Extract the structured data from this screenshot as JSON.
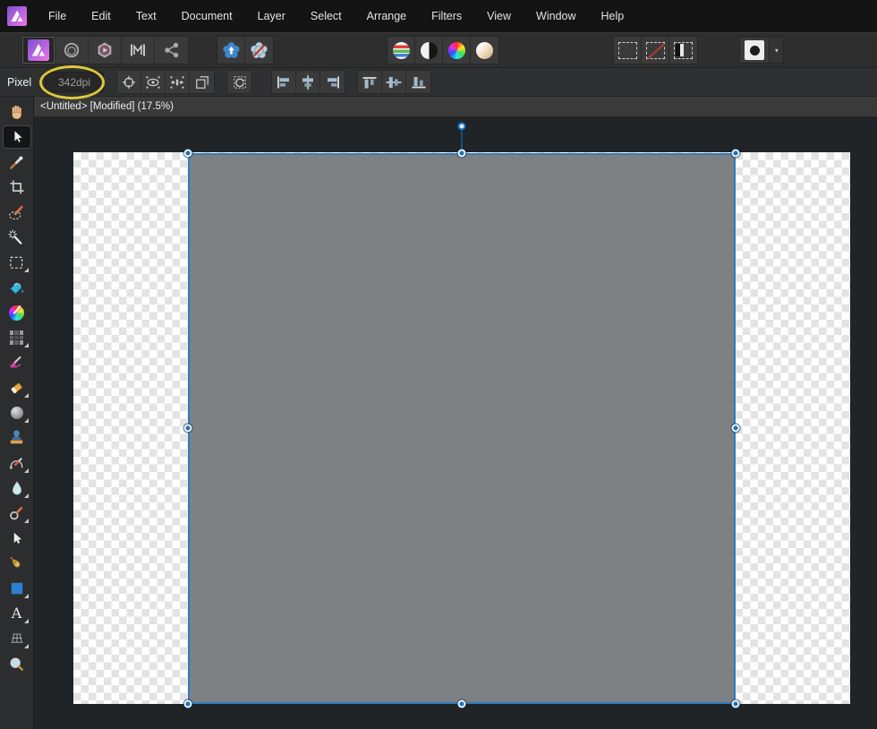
{
  "app": {
    "name_icon": "affinity-photo-logo"
  },
  "menubar": {
    "items": [
      "File",
      "Edit",
      "Text",
      "Document",
      "Layer",
      "Select",
      "Arrange",
      "Filters",
      "View",
      "Window",
      "Help"
    ]
  },
  "toolbar": {
    "personas": [
      "photo-persona",
      "liquify-persona",
      "develop-persona",
      "tone-mapping-persona",
      "export-persona"
    ],
    "active_persona": "photo-persona",
    "toggles": [
      "flower-arrow-toggle",
      "flower-slash-toggle"
    ],
    "auto_adjustments": [
      "auto-levels",
      "auto-contrast",
      "auto-colours",
      "auto-white-balance"
    ],
    "selection_actions": [
      "selection-marquee",
      "deselect",
      "invert-selection"
    ],
    "mask_button": "quick-mask",
    "mask_dropdown": "▼"
  },
  "context_toolbar": {
    "persona_label": "Pixel",
    "dpi_field": {
      "value": "342dpi"
    },
    "move_options": [
      "transform-origin",
      "hide-selection-while-dragging",
      "show-alignment-handles",
      "transform-objects-separately",
      "cycle-selection-box"
    ],
    "align_options": [
      "align-left",
      "align-center-horizontal",
      "align-right",
      "align-top",
      "align-middle-vertical",
      "align-bottom"
    ]
  },
  "document_tab": {
    "title": "<Untitled> [Modified] (17.5%)"
  },
  "tools": {
    "selected": "move-tool",
    "text_glyph": "A",
    "items": [
      "view-tool",
      "move-tool",
      "colour-picker-tool",
      "crop-tool",
      "selection-brush-tool",
      "flood-select-tool",
      "marquee-tool",
      "flood-fill-tool",
      "gradient-tool",
      "pixel-tool",
      "paint-brush-tool",
      "erase-brush-tool",
      "dodge-brush-tool",
      "clone-brush-tool",
      "undo-brush-tool",
      "blur-brush-tool",
      "healing-brush-tool",
      "node-tool",
      "pen-tool",
      "rectangle-tool",
      "artistic-text-tool",
      "mesh-warp-tool",
      "zoom-tool"
    ]
  },
  "canvas": {
    "zoom_percent": "17.5%",
    "selection": {
      "object_fill": "#7e8184",
      "border_color": "#2e7cc0",
      "handle_color": "#1b72ba",
      "handles": [
        "top-left",
        "top-center",
        "top-right",
        "middle-left",
        "middle-right",
        "bottom-left",
        "bottom-center",
        "bottom-right",
        "rotation"
      ]
    }
  },
  "annotation": {
    "shape": "ellipse",
    "color": "#ddc83b",
    "highlights": "dpi-field"
  },
  "colors": {
    "accent_blue": "#2e7cc0",
    "annotation_yellow": "#ddc83b",
    "pasteboard": "#212426",
    "toolbar_bg": "#2e2e2e"
  }
}
